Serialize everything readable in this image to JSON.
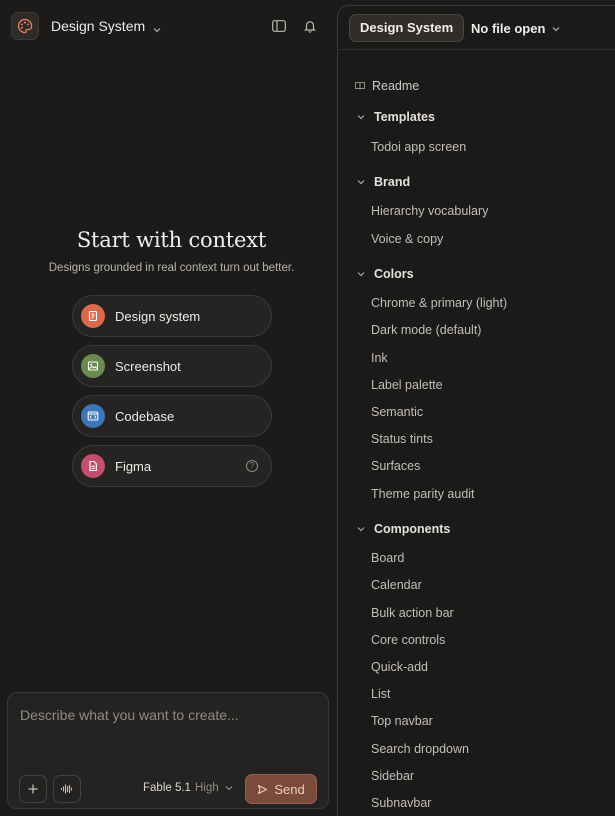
{
  "colors": {
    "design_system_icon": "#d9694a",
    "screenshot_icon": "#6b8a4e",
    "codebase_icon": "#3d76b8",
    "figma_icon": "#c24f6b",
    "send_bg": "#7a4a3a"
  },
  "header": {
    "project_title": "Design System"
  },
  "hero": {
    "title": "Start with context",
    "subtitle": "Designs grounded in real context turn out better."
  },
  "context_options": [
    {
      "label": "Design system",
      "icon": "design-system-icon"
    },
    {
      "label": "Screenshot",
      "icon": "image-icon"
    },
    {
      "label": "Codebase",
      "icon": "code-window-icon"
    },
    {
      "label": "Figma",
      "icon": "document-icon",
      "help": "?"
    }
  ],
  "composer": {
    "placeholder": "Describe what you want to create...",
    "model_name": "Fable 5.1",
    "model_level": "High",
    "send_label": "Send"
  },
  "right_panel": {
    "active_tab": "Design System",
    "file_selector": "No file open",
    "readme": "Readme",
    "sections": [
      {
        "title": "Templates",
        "items": [
          "Todoi app screen"
        ]
      },
      {
        "title": "Brand",
        "items": [
          "Hierarchy vocabulary",
          "Voice & copy"
        ]
      },
      {
        "title": "Colors",
        "items": [
          "Chrome & primary (light)",
          "Dark mode (default)",
          "Ink",
          "Label palette",
          "Semantic",
          "Status tints",
          "Surfaces",
          "Theme parity audit"
        ]
      },
      {
        "title": "Components",
        "items": [
          "Board",
          "Calendar",
          "Bulk action bar",
          "Core controls",
          "Quick-add",
          "List",
          "Top navbar",
          "Search dropdown",
          "Sidebar",
          "Subnavbar"
        ]
      }
    ]
  }
}
